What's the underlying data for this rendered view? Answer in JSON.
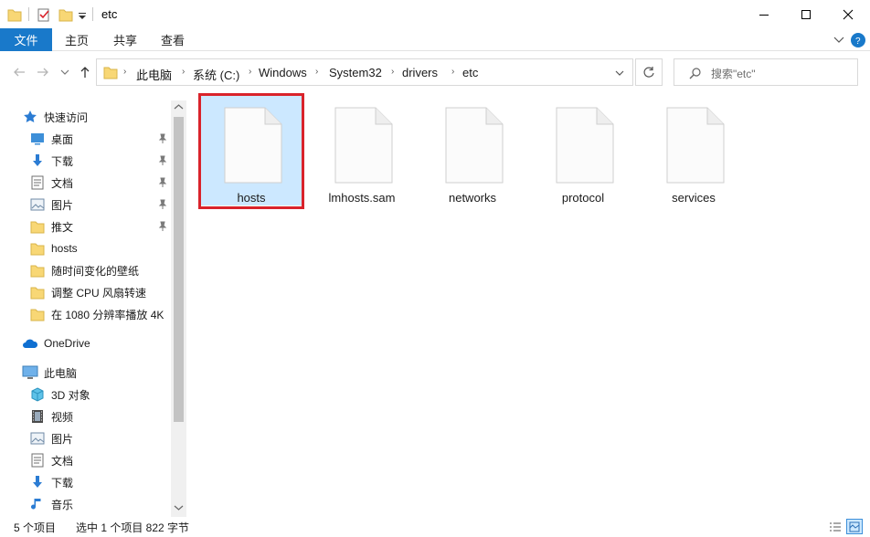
{
  "window": {
    "title": "etc",
    "minimize_label": "─",
    "maximize_label": "☐",
    "close_label": "✕"
  },
  "ribbon": {
    "tabs": [
      "文件",
      "主页",
      "共享",
      "查看"
    ]
  },
  "address": {
    "crumbs": [
      "此电脑",
      "系统 (C:)",
      "Windows",
      "System32",
      "drivers",
      "etc"
    ],
    "search_placeholder": "搜索\"etc\""
  },
  "sidebar": {
    "quick_access_label": "快速访问",
    "quick_items": [
      {
        "label": "桌面",
        "icon": "desktop-icon",
        "pinned": true
      },
      {
        "label": "下载",
        "icon": "download-icon",
        "pinned": true
      },
      {
        "label": "文档",
        "icon": "document-icon",
        "pinned": true
      },
      {
        "label": "图片",
        "icon": "picture-icon",
        "pinned": true
      },
      {
        "label": "推文",
        "icon": "folder-icon",
        "pinned": true
      },
      {
        "label": "hosts",
        "icon": "folder-icon",
        "pinned": false
      },
      {
        "label": "随时间变化的壁纸",
        "icon": "folder-icon",
        "pinned": false
      },
      {
        "label": "调整 CPU 风扇转速",
        "icon": "folder-icon",
        "pinned": false
      },
      {
        "label": "在 1080 分辨率播放 4K",
        "icon": "folder-icon",
        "pinned": false
      }
    ],
    "onedrive_label": "OneDrive",
    "thispc_label": "此电脑",
    "pc_items": [
      {
        "label": "3D 对象",
        "icon": "3d-objects-icon"
      },
      {
        "label": "视频",
        "icon": "video-icon"
      },
      {
        "label": "图片",
        "icon": "picture-icon"
      },
      {
        "label": "文档",
        "icon": "document-icon"
      },
      {
        "label": "下载",
        "icon": "download-icon"
      },
      {
        "label": "音乐",
        "icon": "music-icon"
      }
    ]
  },
  "files": [
    {
      "name": "hosts",
      "selected": true
    },
    {
      "name": "lmhosts.sam",
      "selected": false
    },
    {
      "name": "networks",
      "selected": false
    },
    {
      "name": "protocol",
      "selected": false
    },
    {
      "name": "services",
      "selected": false
    }
  ],
  "status": {
    "count": "5 个项目",
    "selection": "选中 1 个项目  822 字节"
  },
  "colors": {
    "accent": "#1979ca",
    "selection": "#cce8ff",
    "highlight_border": "#d9232b",
    "folder": "#f8d775"
  }
}
